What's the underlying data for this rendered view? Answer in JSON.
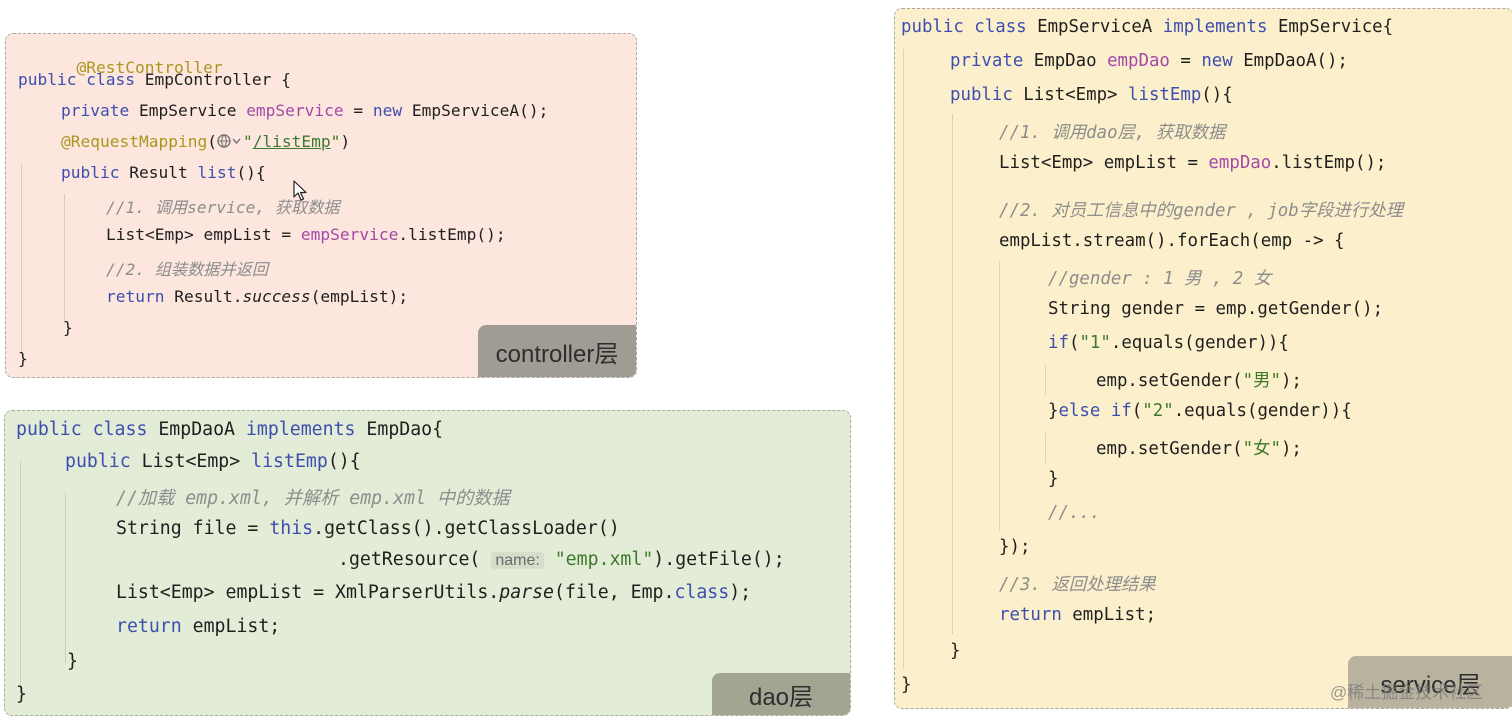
{
  "controller": {
    "label": "controller层",
    "lines": {
      "l1": "@RestController",
      "l2_kw": "public class",
      "l2_name": " EmpController {",
      "l3_kw": "private",
      "l3_type": " EmpService ",
      "l3_field": "empService",
      "l3_eq": " = ",
      "l3_new": "new",
      "l3_rest": " EmpServiceA();",
      "l4_ann": "@RequestMapping",
      "l4_open": "(",
      "l4_q1": "\"",
      "l4_path": "/listEmp",
      "l4_q2": "\"",
      "l4_close": ")",
      "l5_kw": "public",
      "l5_type": " Result ",
      "l5_method": "list",
      "l5_rest": "(){",
      "l6": "//1. 调用service, 获取数据",
      "l7_a": "List<Emp> empList = ",
      "l7_field": "empService",
      "l7_b": ".listEmp();",
      "l8": "//2. 组装数据并返回",
      "l9_kw": "return",
      "l9_a": " Result.",
      "l9_it": "success",
      "l9_b": "(empList);",
      "l10": "}",
      "l11": "}"
    }
  },
  "dao": {
    "label": "dao层",
    "lines": {
      "l1_kw1": "public class",
      "l1_name": " EmpDaoA ",
      "l1_kw2": "implements",
      "l1_rest": " EmpDao{",
      "l2_kw": "public",
      "l2_type": " List<Emp> ",
      "l2_method": "listEmp",
      "l2_rest": "(){",
      "l3": "//加载 emp.xml, 并解析 emp.xml 中的数据",
      "l4_a": "String file = ",
      "l4_this": "this",
      "l4_b": ".getClass().getClassLoader()",
      "l5_a": ".getResource(",
      "l5_hint": "name:",
      "l5_str": "\"emp.xml\"",
      "l5_b": ").getFile();",
      "l6_a": "List<Emp> empList = XmlParserUtils.",
      "l6_it": "parse",
      "l6_b": "(file, Emp.",
      "l6_cls": "class",
      "l6_c": ");",
      "l7_kw": "return",
      "l7_rest": " empList;",
      "l8": "}",
      "l9": "}"
    }
  },
  "service": {
    "label": "service层",
    "lines": {
      "l1_kw1": "public class",
      "l1_name": " EmpServiceA ",
      "l1_kw2": "implements",
      "l1_rest": " EmpService{",
      "l2_kw": "private",
      "l2_type": " EmpDao ",
      "l2_field": "empDao",
      "l2_eq": " = ",
      "l2_new": "new",
      "l2_rest": " EmpDaoA();",
      "l3_kw": "public",
      "l3_type": " List<Emp> ",
      "l3_method": "listEmp",
      "l3_rest": "(){",
      "l4": "//1. 调用dao层, 获取数据",
      "l5_a": "List<Emp> empList = ",
      "l5_field": "empDao",
      "l5_b": ".listEmp();",
      "l6": "//2. 对员工信息中的gender , job字段进行处理",
      "l7": "empList.stream().forEach(emp -> {",
      "l8": "//gender : 1 男 , 2 女",
      "l9": "String gender = emp.getGender();",
      "l10_kw": "if",
      "l10_a": "(",
      "l10_str": "\"1\"",
      "l10_b": ".equals(gender)){",
      "l11_a": "emp.setGender(",
      "l11_str": "\"男\"",
      "l11_b": ");",
      "l12_a": "}",
      "l12_kw": "else if",
      "l12_b": "(",
      "l12_str": "\"2\"",
      "l12_c": ".equals(gender)){",
      "l13_a": "emp.setGender(",
      "l13_str": "\"女\"",
      "l13_b": ");",
      "l14": "}",
      "l15": "//...",
      "l16": "});",
      "l17": "//3. 返回处理结果",
      "l18_kw": "return",
      "l18_rest": " empList;",
      "l19": "}",
      "l20": "}"
    }
  },
  "watermark": "@稀土掘金技术社区"
}
